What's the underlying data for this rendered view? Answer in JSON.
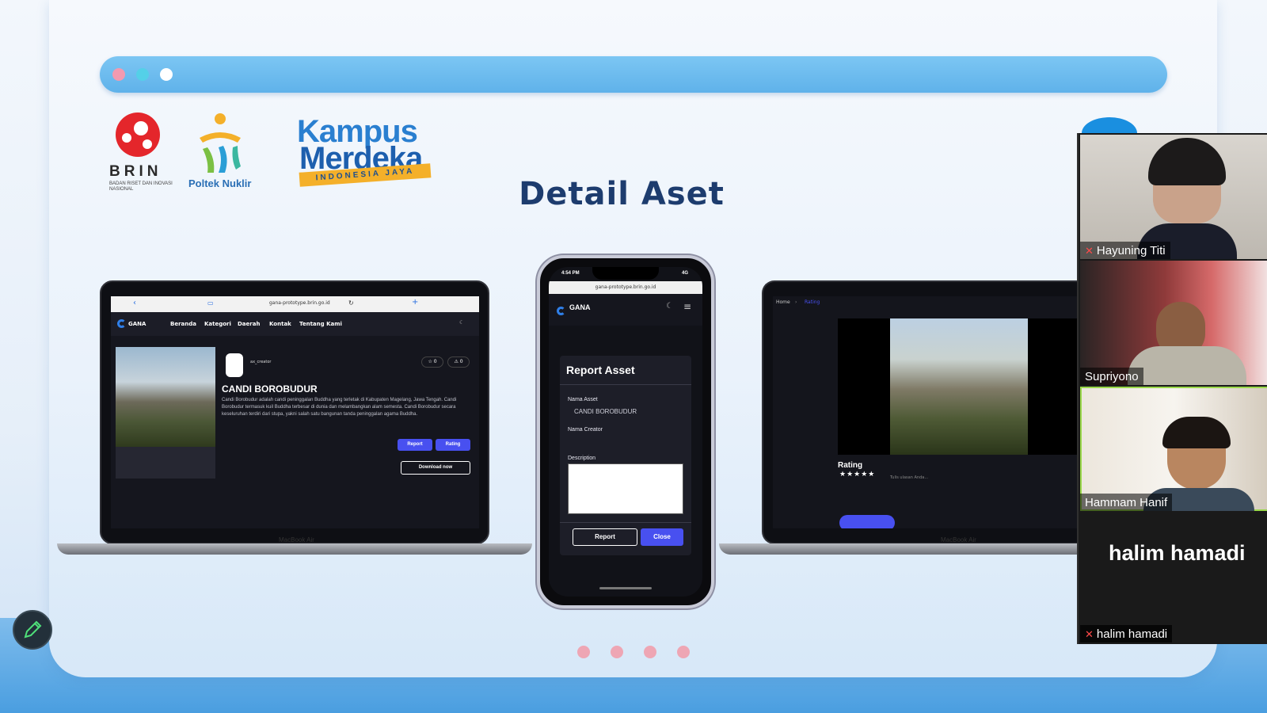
{
  "slide": {
    "title": "Detail Aset",
    "logos": {
      "brin": "BRIN",
      "brin_sub": "BADAN RISET DAN INOVASI NASIONAL",
      "poltek": "Poltek Nuklir",
      "kampus_1": "Kampus",
      "kampus_2": "Merdeka",
      "kampus_band": "INDONESIA JAYA"
    },
    "browser_dots": [
      "#f29ab0",
      "#54d0e8",
      "#ffffff"
    ]
  },
  "laptop1": {
    "url": "gana-prototype.brin.go.id",
    "brand": "GANA",
    "nav": [
      "Beranda",
      "Kategori",
      "Daerah",
      "Kontak",
      "Tentang Kami"
    ],
    "creator": "ax_creator",
    "counts": [
      "0",
      "0"
    ],
    "asset_title": "CANDI BOROBUDUR",
    "description": "Candi Borobudur adalah candi peninggalan Buddha yang terletak di Kabupaten Magelang, Jawa Tengah. Candi Borobudur termasuk kuil Buddha terbesar di dunia dan melambangkan alam semesta. Candi Borobudur secara keseluruhan terdiri dari stupa, yakni salah satu bangunan tanda peninggalan agama Buddha.",
    "btn_report": "Report",
    "btn_rating": "Rating",
    "btn_download": "Download now",
    "label": "MacBook Air"
  },
  "phone": {
    "time": "4:54 PM",
    "signal": "4G",
    "url": "gana-prototype.brin.go.id",
    "brand": "GANA",
    "modal_title": "Report Asset",
    "label_asset": "Nama Asset",
    "value_asset": "CANDI BOROBUDUR",
    "label_creator": "Nama Creator",
    "label_desc": "Description",
    "btn_report": "Report",
    "btn_close": "Close"
  },
  "laptop2": {
    "crumb_home": "Home",
    "crumb_current": "Rating",
    "rating_label": "Rating",
    "stars": "★★★★★",
    "placeholder": "Tulis ulasan Anda...",
    "label": "MacBook Air"
  },
  "participants": [
    {
      "name": "Hayuning Titi",
      "muted": true
    },
    {
      "name": "Supriyono",
      "muted": false
    },
    {
      "name": "Hammam Hanif",
      "muted": false,
      "active": true
    },
    {
      "name": "halim hamadi",
      "muted": true
    }
  ],
  "big_name": "halim hamadi",
  "colors": {
    "accent_blue": "#4850f0",
    "active_speaker": "#9ad84a"
  }
}
